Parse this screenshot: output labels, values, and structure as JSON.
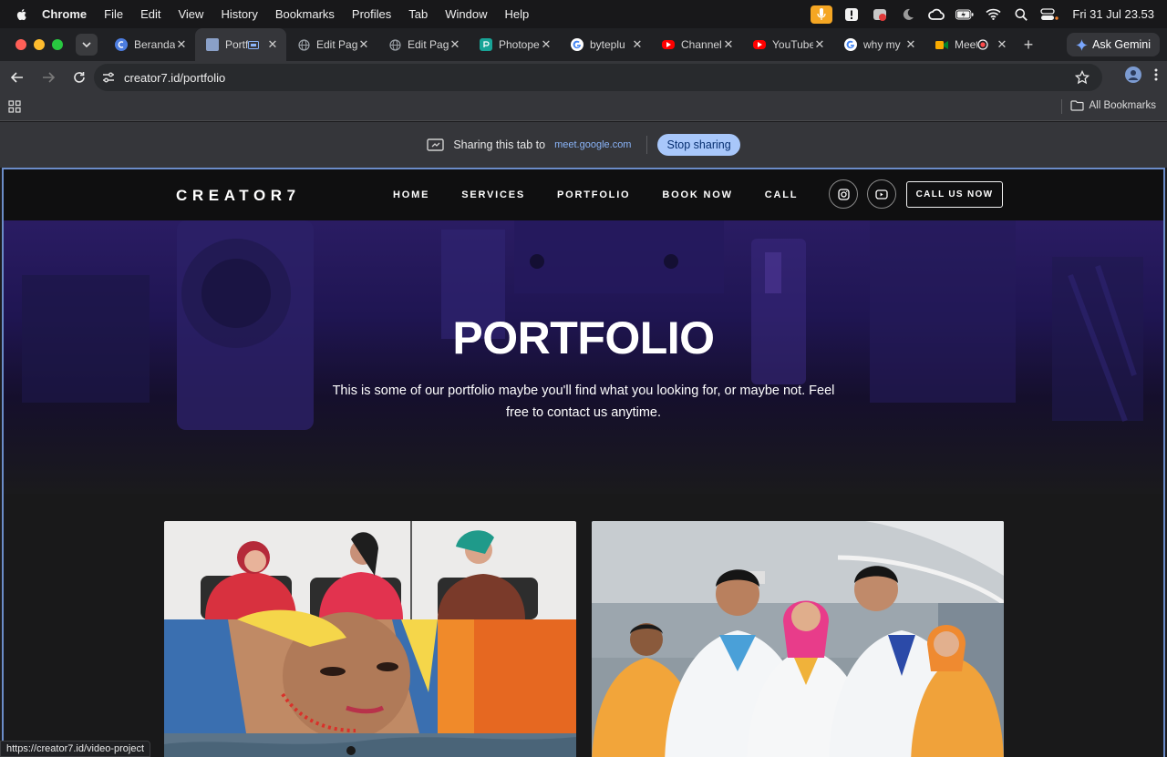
{
  "menubar": {
    "items": [
      "Chrome",
      "File",
      "Edit",
      "View",
      "History",
      "Bookmarks",
      "Profiles",
      "Tab",
      "Window",
      "Help"
    ],
    "clock": "Fri 31 Jul  23.53"
  },
  "tabs": [
    {
      "title": "Beranda",
      "favicon": "creator-icon",
      "color": "#4c7de0"
    },
    {
      "title": "Portf",
      "favicon": "page-thumb-icon",
      "color": "#8aa0c8",
      "active": true
    },
    {
      "title": "Edit Pag",
      "favicon": "globe-icon",
      "color": "#9aa0a6"
    },
    {
      "title": "Edit Pag",
      "favicon": "globe-icon",
      "color": "#9aa0a6"
    },
    {
      "title": "Photope",
      "favicon": "photopea-icon",
      "color": "#18a497"
    },
    {
      "title": "byteplu",
      "favicon": "google-icon",
      "color": "#ffffff"
    },
    {
      "title": "Channel",
      "favicon": "youtube-icon",
      "color": "#ff0000"
    },
    {
      "title": "YouTube",
      "favicon": "youtube-icon",
      "color": "#ff0000"
    },
    {
      "title": "why my",
      "favicon": "google-icon",
      "color": "#ffffff"
    },
    {
      "title": "Meet",
      "favicon": "meet-icon",
      "color": "#f9ab00"
    }
  ],
  "gemini_label": "Ask Gemini",
  "address": "creator7.id/portfolio",
  "bookmarks": {
    "all": "All Bookmarks"
  },
  "sharebar": {
    "text": "Sharing this tab to",
    "domain": "meet.google.com",
    "stop": "Stop sharing"
  },
  "site": {
    "logo": "CREATOR7",
    "nav": [
      "HOME",
      "SERVICES",
      "PORTFOLIO",
      "BOOK NOW",
      "CALL"
    ],
    "cta": "CALL US NOW",
    "hero_title": "PORTFOLIO",
    "hero_desc": "This is some of our portfolio maybe you'll find what you looking for, or maybe not. Feel free to contact us anytime."
  },
  "status_url": "https://creator7.id/video-project"
}
